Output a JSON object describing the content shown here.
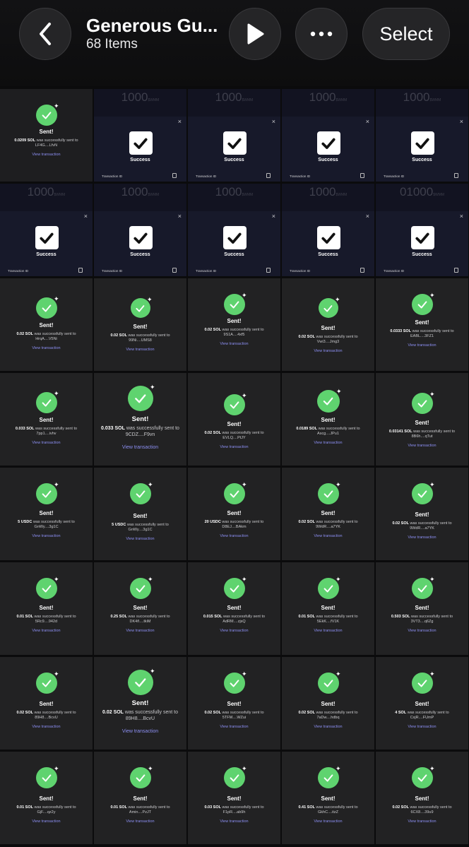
{
  "header": {
    "title": "Generous Gu...",
    "item_count": "68 Items",
    "select_label": "Select",
    "back_icon": "chevron-left-icon",
    "play_icon": "play-icon",
    "more_icon": "ellipsis-icon"
  },
  "colors": {
    "check_green": "#5fd36f",
    "link_purple": "#8c8ff2",
    "success_card": "#17192a"
  },
  "success_strings": {
    "label": "Success",
    "footer": "Transaction ID",
    "close": "×"
  },
  "sent_strings": {
    "label": "Sent!",
    "middle": " was successfully sent to",
    "view": "View transaction"
  },
  "success_amounts": [
    "1000",
    "1000",
    "1000",
    "1000",
    "1000",
    "1000",
    "1000",
    "1000",
    "01000",
    "1000"
  ],
  "success_unit": "$WMM",
  "tiles": [
    {
      "amount": "0.0209 SOL",
      "to": "LF4G....LfvN"
    },
    {
      "amount": "0.02 SOL",
      "to": "HrqA....V5Ni"
    },
    {
      "amount": "0.02 SOL",
      "to": "99Ni....UMS8"
    },
    {
      "amount": "0.02 SOL",
      "to": "9S1A....4xf5"
    },
    {
      "amount": "0.02 SOL",
      "to": "Vwi3....Jmg3"
    },
    {
      "amount": "0.0333 SOL",
      "to": "EABL....3FZ1"
    },
    {
      "amount": "0.033 SOL",
      "to": "7pp1....ivhv"
    },
    {
      "amount": "0.033 SOL",
      "to": "9CDZ....F9vn"
    },
    {
      "amount": "0.02 SOL",
      "to": "EVLQ....PtJY"
    },
    {
      "amount": "0.0189 SOL",
      "to": "Ascg....JPu1"
    },
    {
      "amount": "0.03141 SOL",
      "to": "8B6h....qTut"
    },
    {
      "amount": "5 USDC",
      "to": "GnWy....3g1C"
    },
    {
      "amount": "5 USDC",
      "to": "GnWy....3g1C"
    },
    {
      "amount": "20 USDC",
      "to": "D8EJ....BAkm"
    },
    {
      "amount": "0.02 SOL",
      "to": "9WdR....a7YK"
    },
    {
      "amount": "0.02 SOL",
      "to": "9WdR....a7YK"
    },
    {
      "amount": "0.01 SOL",
      "to": "5Rc9....942d"
    },
    {
      "amount": "0.25 SOL",
      "to": "DK4ñ....tkiM"
    },
    {
      "amount": "0.015 SOL",
      "to": "AdRM....zjsQ"
    },
    {
      "amount": "0.01 SOL",
      "to": "5EkK....fV1K"
    },
    {
      "amount": "0.503 SOL",
      "to": "3VT3....q6Zg"
    },
    {
      "amount": "0.02 SOL",
      "to": "89H8....BcvU"
    },
    {
      "amount": "0.02 SOL",
      "to": "89H8....BcvU"
    },
    {
      "amount": "0.02 SOL",
      "to": "5TFM....WZui"
    },
    {
      "amount": "0.02 SOL",
      "to": "7aDw....hdbq"
    },
    {
      "amount": "4 SOL",
      "to": "CxjR....FUmP"
    },
    {
      "amount": "0.01 SOL",
      "to": "GjF....qz2y"
    },
    {
      "amount": "0.01 SOL",
      "to": "Amin....PzJT"
    },
    {
      "amount": "0.03 SOL",
      "to": "F1pR....ab9h"
    },
    {
      "amount": "0.41 SOL",
      "to": "GkhC....itzZ"
    },
    {
      "amount": "0.02 SOL",
      "to": "6CX8....39u9"
    }
  ]
}
